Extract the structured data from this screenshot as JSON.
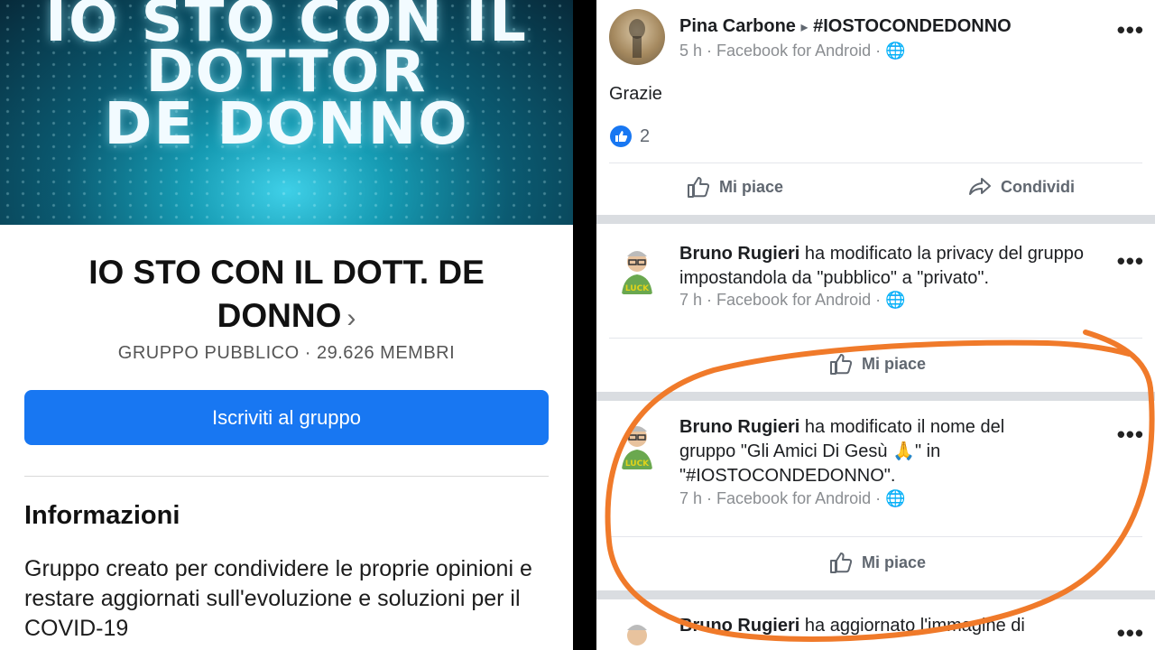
{
  "left": {
    "cover_lines": [
      "IO STO CON IL",
      "DOTTOR",
      "DE DONNO"
    ],
    "group_title_line1": "IO STO CON IL DOTT. DE",
    "group_title_line2": "DONNO",
    "title_chevron": "›",
    "group_meta": "GRUPPO PUBBLICO · 29.626 MEMBRI",
    "join_button": "Iscriviti al gruppo",
    "info_heading": "Informazioni",
    "info_description": "Gruppo creato per condividere le proprie opinioni e restare aggiornati sull'evoluzione e soluzioni per il COVID-19"
  },
  "right": {
    "post1": {
      "author": "Pina Carbone",
      "arrow": "▸",
      "target": "#IOSTOCONDEDONNO",
      "meta": "5 h · Facebook for Android · ",
      "text": "Grazie",
      "likes": "2",
      "like_label": "Mi piace",
      "share_label": "Condividi",
      "more": "•••"
    },
    "post2": {
      "author": "Bruno Rugieri",
      "text": " ha modificato la privacy del gruppo impostandola da \"pubblico\" a \"privato\".",
      "meta": "7 h · Facebook for Android · ",
      "like_label": "Mi piace",
      "more": "•••"
    },
    "post3": {
      "author": "Bruno Rugieri",
      "text": " ha modificato il nome del gruppo \"Gli Amici Di Gesù 🙏\" in \"#IOSTOCONDEDONNO\".",
      "meta": "7 h · Facebook for Android · ",
      "like_label": "Mi piace",
      "more": "•••"
    },
    "post4": {
      "author": "Bruno Rugieri",
      "text": " ha aggiornato l'immagine di",
      "more": "•••"
    }
  },
  "colors": {
    "accent": "#1877f2",
    "highlight_circle": "#f07a2a"
  }
}
